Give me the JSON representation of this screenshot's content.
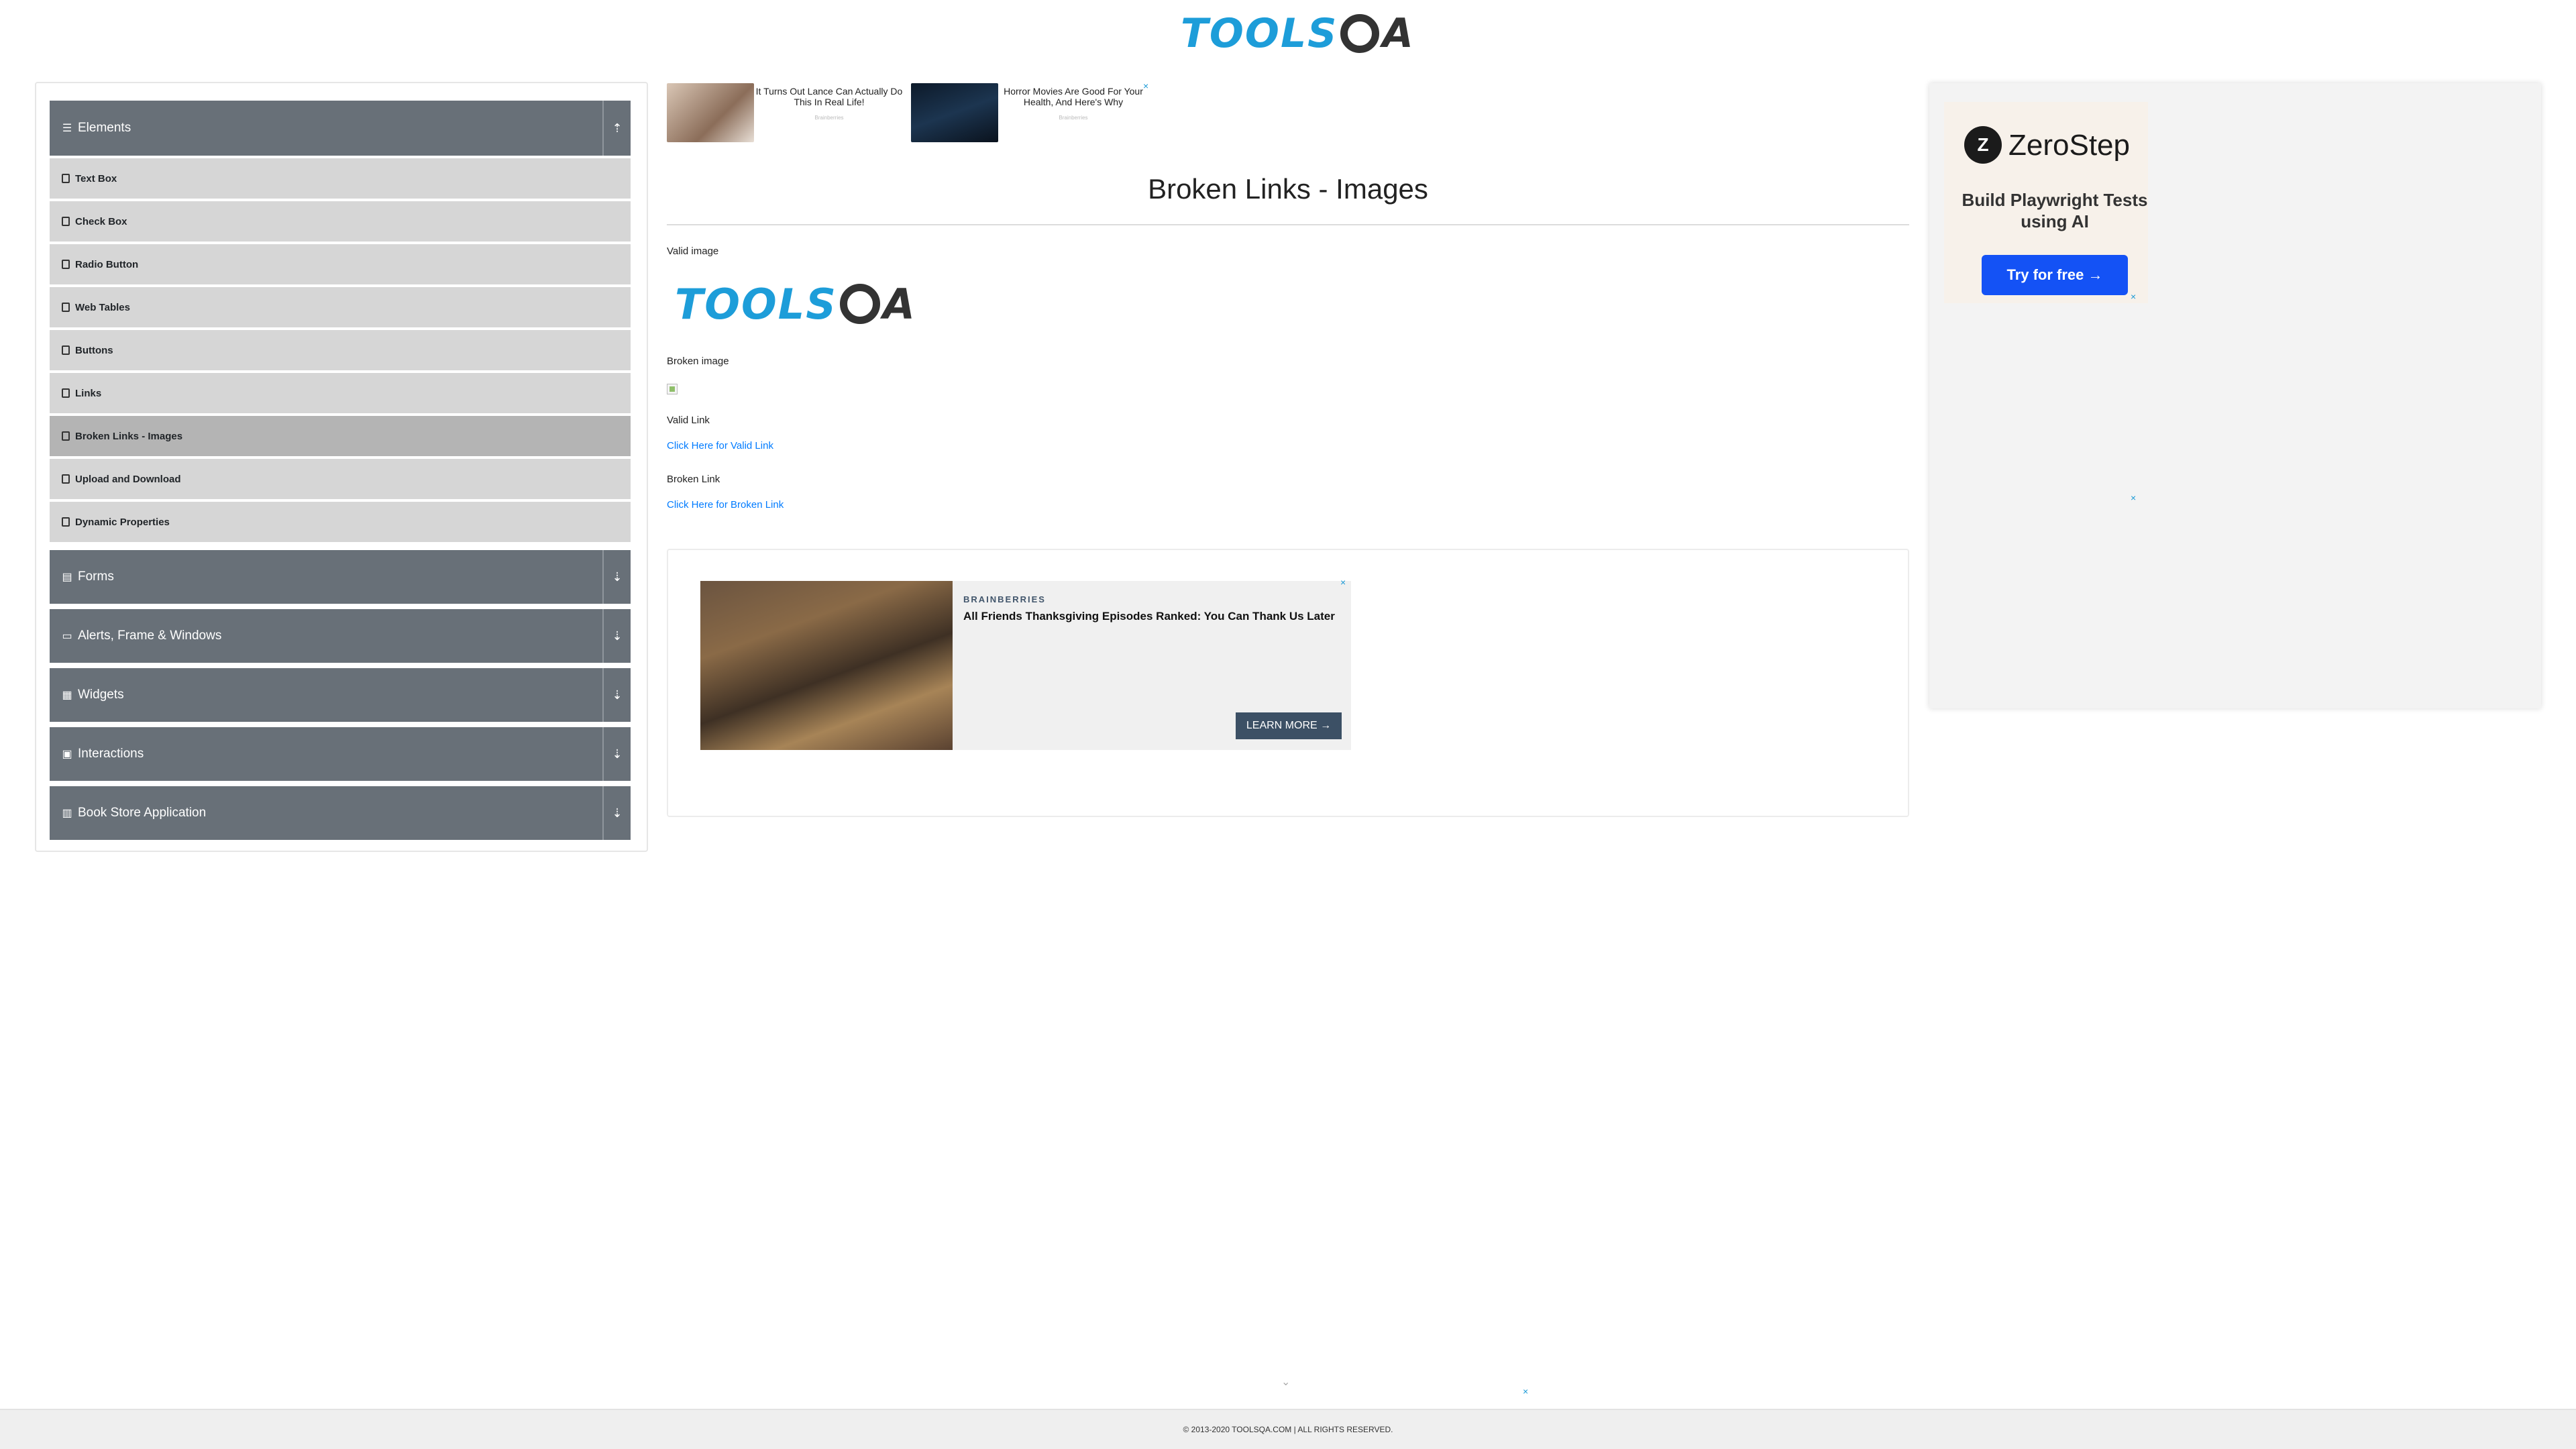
{
  "header": {
    "logo_tools": "TOOLS",
    "logo_qa": "A"
  },
  "sidebar": {
    "groups": [
      {
        "label": "Elements",
        "icon": "bars-icon",
        "expanded": true
      },
      {
        "label": "Forms",
        "icon": "file-icon",
        "expanded": false
      },
      {
        "label": "Alerts, Frame & Windows",
        "icon": "window-icon",
        "expanded": false
      },
      {
        "label": "Widgets",
        "icon": "grid-icon",
        "expanded": false
      },
      {
        "label": "Interactions",
        "icon": "interactions-icon",
        "expanded": false
      },
      {
        "label": "Book Store Application",
        "icon": "book-icon",
        "expanded": false
      }
    ],
    "items": [
      {
        "label": "Text Box"
      },
      {
        "label": "Check Box"
      },
      {
        "label": "Radio Button"
      },
      {
        "label": "Web Tables"
      },
      {
        "label": "Buttons"
      },
      {
        "label": "Links"
      },
      {
        "label": "Broken Links - Images",
        "active": true
      },
      {
        "label": "Upload and Download"
      },
      {
        "label": "Dynamic Properties"
      }
    ]
  },
  "ads": {
    "top": [
      {
        "text": "It Turns Out Lance Can Actually Do This In Real Life!",
        "source": "Brainberries"
      },
      {
        "text": "Horror Movies Are Good For Your Health, And Here's Why",
        "source": "Brainberries"
      }
    ],
    "middle": {
      "brand": "BRAINBERRIES",
      "title": "All Friends Thanksgiving Episodes Ranked: You Can Thank Us Later",
      "button": "LEARN MORE →"
    },
    "right": {
      "logo_letter": "Z",
      "name": "ZeroStep",
      "tagline": "Build Playwright Tests using AI",
      "button": "Try for free →"
    },
    "close_glyph": "×"
  },
  "main": {
    "title": "Broken Links - Images",
    "valid_image_label": "Valid image",
    "broken_image_label": "Broken image",
    "valid_link_label": "Valid Link",
    "valid_link_text": "Click Here for Valid Link",
    "broken_link_label": "Broken Link",
    "broken_link_text": "Click Here for Broken Link"
  },
  "footer": {
    "text": "© 2013-2020 TOOLSQA.COM | ALL RIGHTS RESERVED."
  },
  "colors": {
    "accent": "#1d9dd9",
    "menu_header": "#687078",
    "link": "#007bff",
    "cta": "#1452f5"
  }
}
